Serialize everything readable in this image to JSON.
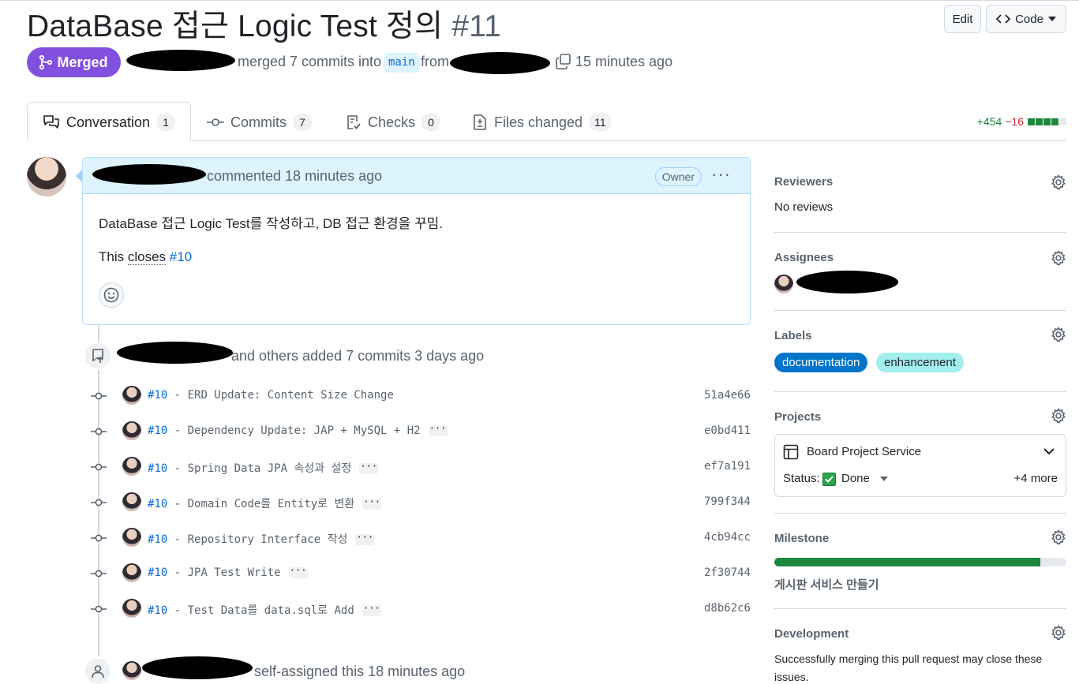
{
  "header": {
    "title": "DataBase 접근 Logic Test 정의",
    "number": "#11",
    "edit_label": "Edit",
    "code_label": "Code"
  },
  "meta": {
    "state": "Merged",
    "merged_text": "merged 7 commits into",
    "base_branch": "main",
    "from_text": "from",
    "time": "15 minutes ago"
  },
  "tabs": [
    {
      "label": "Conversation",
      "count": "1"
    },
    {
      "label": "Commits",
      "count": "7"
    },
    {
      "label": "Checks",
      "count": "0"
    },
    {
      "label": "Files changed",
      "count": "11"
    }
  ],
  "diffstat": {
    "additions": "+454",
    "deletions": "−16"
  },
  "comment": {
    "header_text": "commented 18 minutes ago",
    "role_badge": "Owner",
    "body_line1": "DataBase 접근 Logic Test를 작성하고, DB 접근 환경을 꾸밈.",
    "closes_prefix": "This",
    "closes_word": "closes",
    "closes_ref": "#10"
  },
  "commits_event": {
    "text": "and others added 7 commits 3 days ago",
    "commits": [
      {
        "ref": "#10",
        "message": " - ERD Update: Content Size Change",
        "sha": "51a4e66",
        "has_more": false
      },
      {
        "ref": "#10",
        "message": " - Dependency Update: JAP + MySQL + H2",
        "sha": "e0bd411",
        "has_more": true
      },
      {
        "ref": "#10",
        "message": " - Spring Data JPA 속성과 설정",
        "sha": "ef7a191",
        "has_more": true
      },
      {
        "ref": "#10",
        "message": " - Domain Code를 Entity로 변환",
        "sha": "799f344",
        "has_more": true
      },
      {
        "ref": "#10",
        "message": " - Repository Interface 작성",
        "sha": "4cb94cc",
        "has_more": true
      },
      {
        "ref": "#10",
        "message": " - JPA Test Write",
        "sha": "2f30744",
        "has_more": true
      },
      {
        "ref": "#10",
        "message": " - Test Data를 data.sql로 Add",
        "sha": "d8b62c6",
        "has_more": true
      }
    ]
  },
  "assign_event": {
    "text": "self-assigned this 18 minutes ago"
  },
  "sidebar": {
    "reviewers": {
      "title": "Reviewers",
      "value": "No reviews"
    },
    "assignees": {
      "title": "Assignees"
    },
    "labels": {
      "title": "Labels",
      "items": [
        {
          "name": "documentation",
          "bg": "#0075ca",
          "fg": "#ffffff"
        },
        {
          "name": "enhancement",
          "bg": "#a2eeef",
          "fg": "#1f2328"
        }
      ]
    },
    "projects": {
      "title": "Projects",
      "project_name": "Board Project Service",
      "status_label": "Status:",
      "status_value": "Done",
      "more": "+4 more"
    },
    "milestone": {
      "title": "Milestone",
      "name": "게시판 서비스 만들기",
      "progress": 0.91
    },
    "development": {
      "title": "Development",
      "text_line1": "Successfully merging this pull request may close these",
      "text_line2": "issues."
    }
  },
  "colors": {
    "merged": "#8250df",
    "link": "#0969da",
    "additions": "#1a7f37",
    "deletions": "#d1242f"
  }
}
